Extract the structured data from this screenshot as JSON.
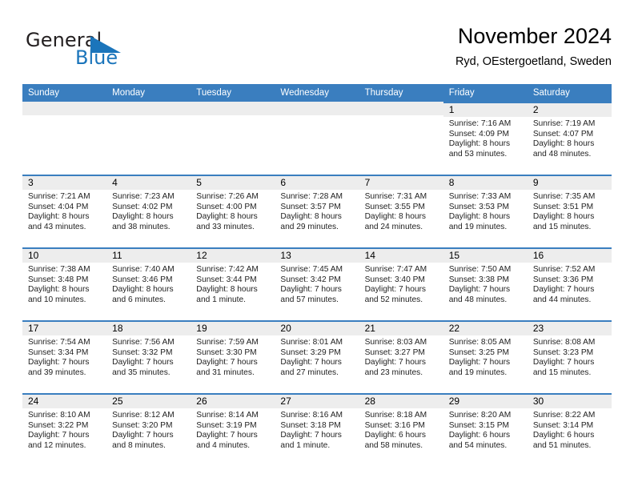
{
  "brand": {
    "name_part1": "General",
    "name_part2": "Blue",
    "mark": "triangle-flag",
    "color_blue": "#1b75bb",
    "color_dark": "#231f20"
  },
  "header": {
    "title": "November 2024",
    "location": "Ryd, OEstergoetland, Sweden"
  },
  "theme": {
    "header_bg": "#3a7ebf",
    "daynum_bg": "#ededed",
    "row_rule": "#3a7ebf"
  },
  "weekday_headers": [
    "Sunday",
    "Monday",
    "Tuesday",
    "Wednesday",
    "Thursday",
    "Friday",
    "Saturday"
  ],
  "weeks": [
    [
      {
        "day": "",
        "sunrise": "",
        "sunset": "",
        "daylight_line1": "",
        "daylight_line2": ""
      },
      {
        "day": "",
        "sunrise": "",
        "sunset": "",
        "daylight_line1": "",
        "daylight_line2": ""
      },
      {
        "day": "",
        "sunrise": "",
        "sunset": "",
        "daylight_line1": "",
        "daylight_line2": ""
      },
      {
        "day": "",
        "sunrise": "",
        "sunset": "",
        "daylight_line1": "",
        "daylight_line2": ""
      },
      {
        "day": "",
        "sunrise": "",
        "sunset": "",
        "daylight_line1": "",
        "daylight_line2": ""
      },
      {
        "day": "1",
        "sunrise": "Sunrise: 7:16 AM",
        "sunset": "Sunset: 4:09 PM",
        "daylight_line1": "Daylight: 8 hours",
        "daylight_line2": "and 53 minutes."
      },
      {
        "day": "2",
        "sunrise": "Sunrise: 7:19 AM",
        "sunset": "Sunset: 4:07 PM",
        "daylight_line1": "Daylight: 8 hours",
        "daylight_line2": "and 48 minutes."
      }
    ],
    [
      {
        "day": "3",
        "sunrise": "Sunrise: 7:21 AM",
        "sunset": "Sunset: 4:04 PM",
        "daylight_line1": "Daylight: 8 hours",
        "daylight_line2": "and 43 minutes."
      },
      {
        "day": "4",
        "sunrise": "Sunrise: 7:23 AM",
        "sunset": "Sunset: 4:02 PM",
        "daylight_line1": "Daylight: 8 hours",
        "daylight_line2": "and 38 minutes."
      },
      {
        "day": "5",
        "sunrise": "Sunrise: 7:26 AM",
        "sunset": "Sunset: 4:00 PM",
        "daylight_line1": "Daylight: 8 hours",
        "daylight_line2": "and 33 minutes."
      },
      {
        "day": "6",
        "sunrise": "Sunrise: 7:28 AM",
        "sunset": "Sunset: 3:57 PM",
        "daylight_line1": "Daylight: 8 hours",
        "daylight_line2": "and 29 minutes."
      },
      {
        "day": "7",
        "sunrise": "Sunrise: 7:31 AM",
        "sunset": "Sunset: 3:55 PM",
        "daylight_line1": "Daylight: 8 hours",
        "daylight_line2": "and 24 minutes."
      },
      {
        "day": "8",
        "sunrise": "Sunrise: 7:33 AM",
        "sunset": "Sunset: 3:53 PM",
        "daylight_line1": "Daylight: 8 hours",
        "daylight_line2": "and 19 minutes."
      },
      {
        "day": "9",
        "sunrise": "Sunrise: 7:35 AM",
        "sunset": "Sunset: 3:51 PM",
        "daylight_line1": "Daylight: 8 hours",
        "daylight_line2": "and 15 minutes."
      }
    ],
    [
      {
        "day": "10",
        "sunrise": "Sunrise: 7:38 AM",
        "sunset": "Sunset: 3:48 PM",
        "daylight_line1": "Daylight: 8 hours",
        "daylight_line2": "and 10 minutes."
      },
      {
        "day": "11",
        "sunrise": "Sunrise: 7:40 AM",
        "sunset": "Sunset: 3:46 PM",
        "daylight_line1": "Daylight: 8 hours",
        "daylight_line2": "and 6 minutes."
      },
      {
        "day": "12",
        "sunrise": "Sunrise: 7:42 AM",
        "sunset": "Sunset: 3:44 PM",
        "daylight_line1": "Daylight: 8 hours",
        "daylight_line2": "and 1 minute."
      },
      {
        "day": "13",
        "sunrise": "Sunrise: 7:45 AM",
        "sunset": "Sunset: 3:42 PM",
        "daylight_line1": "Daylight: 7 hours",
        "daylight_line2": "and 57 minutes."
      },
      {
        "day": "14",
        "sunrise": "Sunrise: 7:47 AM",
        "sunset": "Sunset: 3:40 PM",
        "daylight_line1": "Daylight: 7 hours",
        "daylight_line2": "and 52 minutes."
      },
      {
        "day": "15",
        "sunrise": "Sunrise: 7:50 AM",
        "sunset": "Sunset: 3:38 PM",
        "daylight_line1": "Daylight: 7 hours",
        "daylight_line2": "and 48 minutes."
      },
      {
        "day": "16",
        "sunrise": "Sunrise: 7:52 AM",
        "sunset": "Sunset: 3:36 PM",
        "daylight_line1": "Daylight: 7 hours",
        "daylight_line2": "and 44 minutes."
      }
    ],
    [
      {
        "day": "17",
        "sunrise": "Sunrise: 7:54 AM",
        "sunset": "Sunset: 3:34 PM",
        "daylight_line1": "Daylight: 7 hours",
        "daylight_line2": "and 39 minutes."
      },
      {
        "day": "18",
        "sunrise": "Sunrise: 7:56 AM",
        "sunset": "Sunset: 3:32 PM",
        "daylight_line1": "Daylight: 7 hours",
        "daylight_line2": "and 35 minutes."
      },
      {
        "day": "19",
        "sunrise": "Sunrise: 7:59 AM",
        "sunset": "Sunset: 3:30 PM",
        "daylight_line1": "Daylight: 7 hours",
        "daylight_line2": "and 31 minutes."
      },
      {
        "day": "20",
        "sunrise": "Sunrise: 8:01 AM",
        "sunset": "Sunset: 3:29 PM",
        "daylight_line1": "Daylight: 7 hours",
        "daylight_line2": "and 27 minutes."
      },
      {
        "day": "21",
        "sunrise": "Sunrise: 8:03 AM",
        "sunset": "Sunset: 3:27 PM",
        "daylight_line1": "Daylight: 7 hours",
        "daylight_line2": "and 23 minutes."
      },
      {
        "day": "22",
        "sunrise": "Sunrise: 8:05 AM",
        "sunset": "Sunset: 3:25 PM",
        "daylight_line1": "Daylight: 7 hours",
        "daylight_line2": "and 19 minutes."
      },
      {
        "day": "23",
        "sunrise": "Sunrise: 8:08 AM",
        "sunset": "Sunset: 3:23 PM",
        "daylight_line1": "Daylight: 7 hours",
        "daylight_line2": "and 15 minutes."
      }
    ],
    [
      {
        "day": "24",
        "sunrise": "Sunrise: 8:10 AM",
        "sunset": "Sunset: 3:22 PM",
        "daylight_line1": "Daylight: 7 hours",
        "daylight_line2": "and 12 minutes."
      },
      {
        "day": "25",
        "sunrise": "Sunrise: 8:12 AM",
        "sunset": "Sunset: 3:20 PM",
        "daylight_line1": "Daylight: 7 hours",
        "daylight_line2": "and 8 minutes."
      },
      {
        "day": "26",
        "sunrise": "Sunrise: 8:14 AM",
        "sunset": "Sunset: 3:19 PM",
        "daylight_line1": "Daylight: 7 hours",
        "daylight_line2": "and 4 minutes."
      },
      {
        "day": "27",
        "sunrise": "Sunrise: 8:16 AM",
        "sunset": "Sunset: 3:18 PM",
        "daylight_line1": "Daylight: 7 hours",
        "daylight_line2": "and 1 minute."
      },
      {
        "day": "28",
        "sunrise": "Sunrise: 8:18 AM",
        "sunset": "Sunset: 3:16 PM",
        "daylight_line1": "Daylight: 6 hours",
        "daylight_line2": "and 58 minutes."
      },
      {
        "day": "29",
        "sunrise": "Sunrise: 8:20 AM",
        "sunset": "Sunset: 3:15 PM",
        "daylight_line1": "Daylight: 6 hours",
        "daylight_line2": "and 54 minutes."
      },
      {
        "day": "30",
        "sunrise": "Sunrise: 8:22 AM",
        "sunset": "Sunset: 3:14 PM",
        "daylight_line1": "Daylight: 6 hours",
        "daylight_line2": "and 51 minutes."
      }
    ]
  ]
}
